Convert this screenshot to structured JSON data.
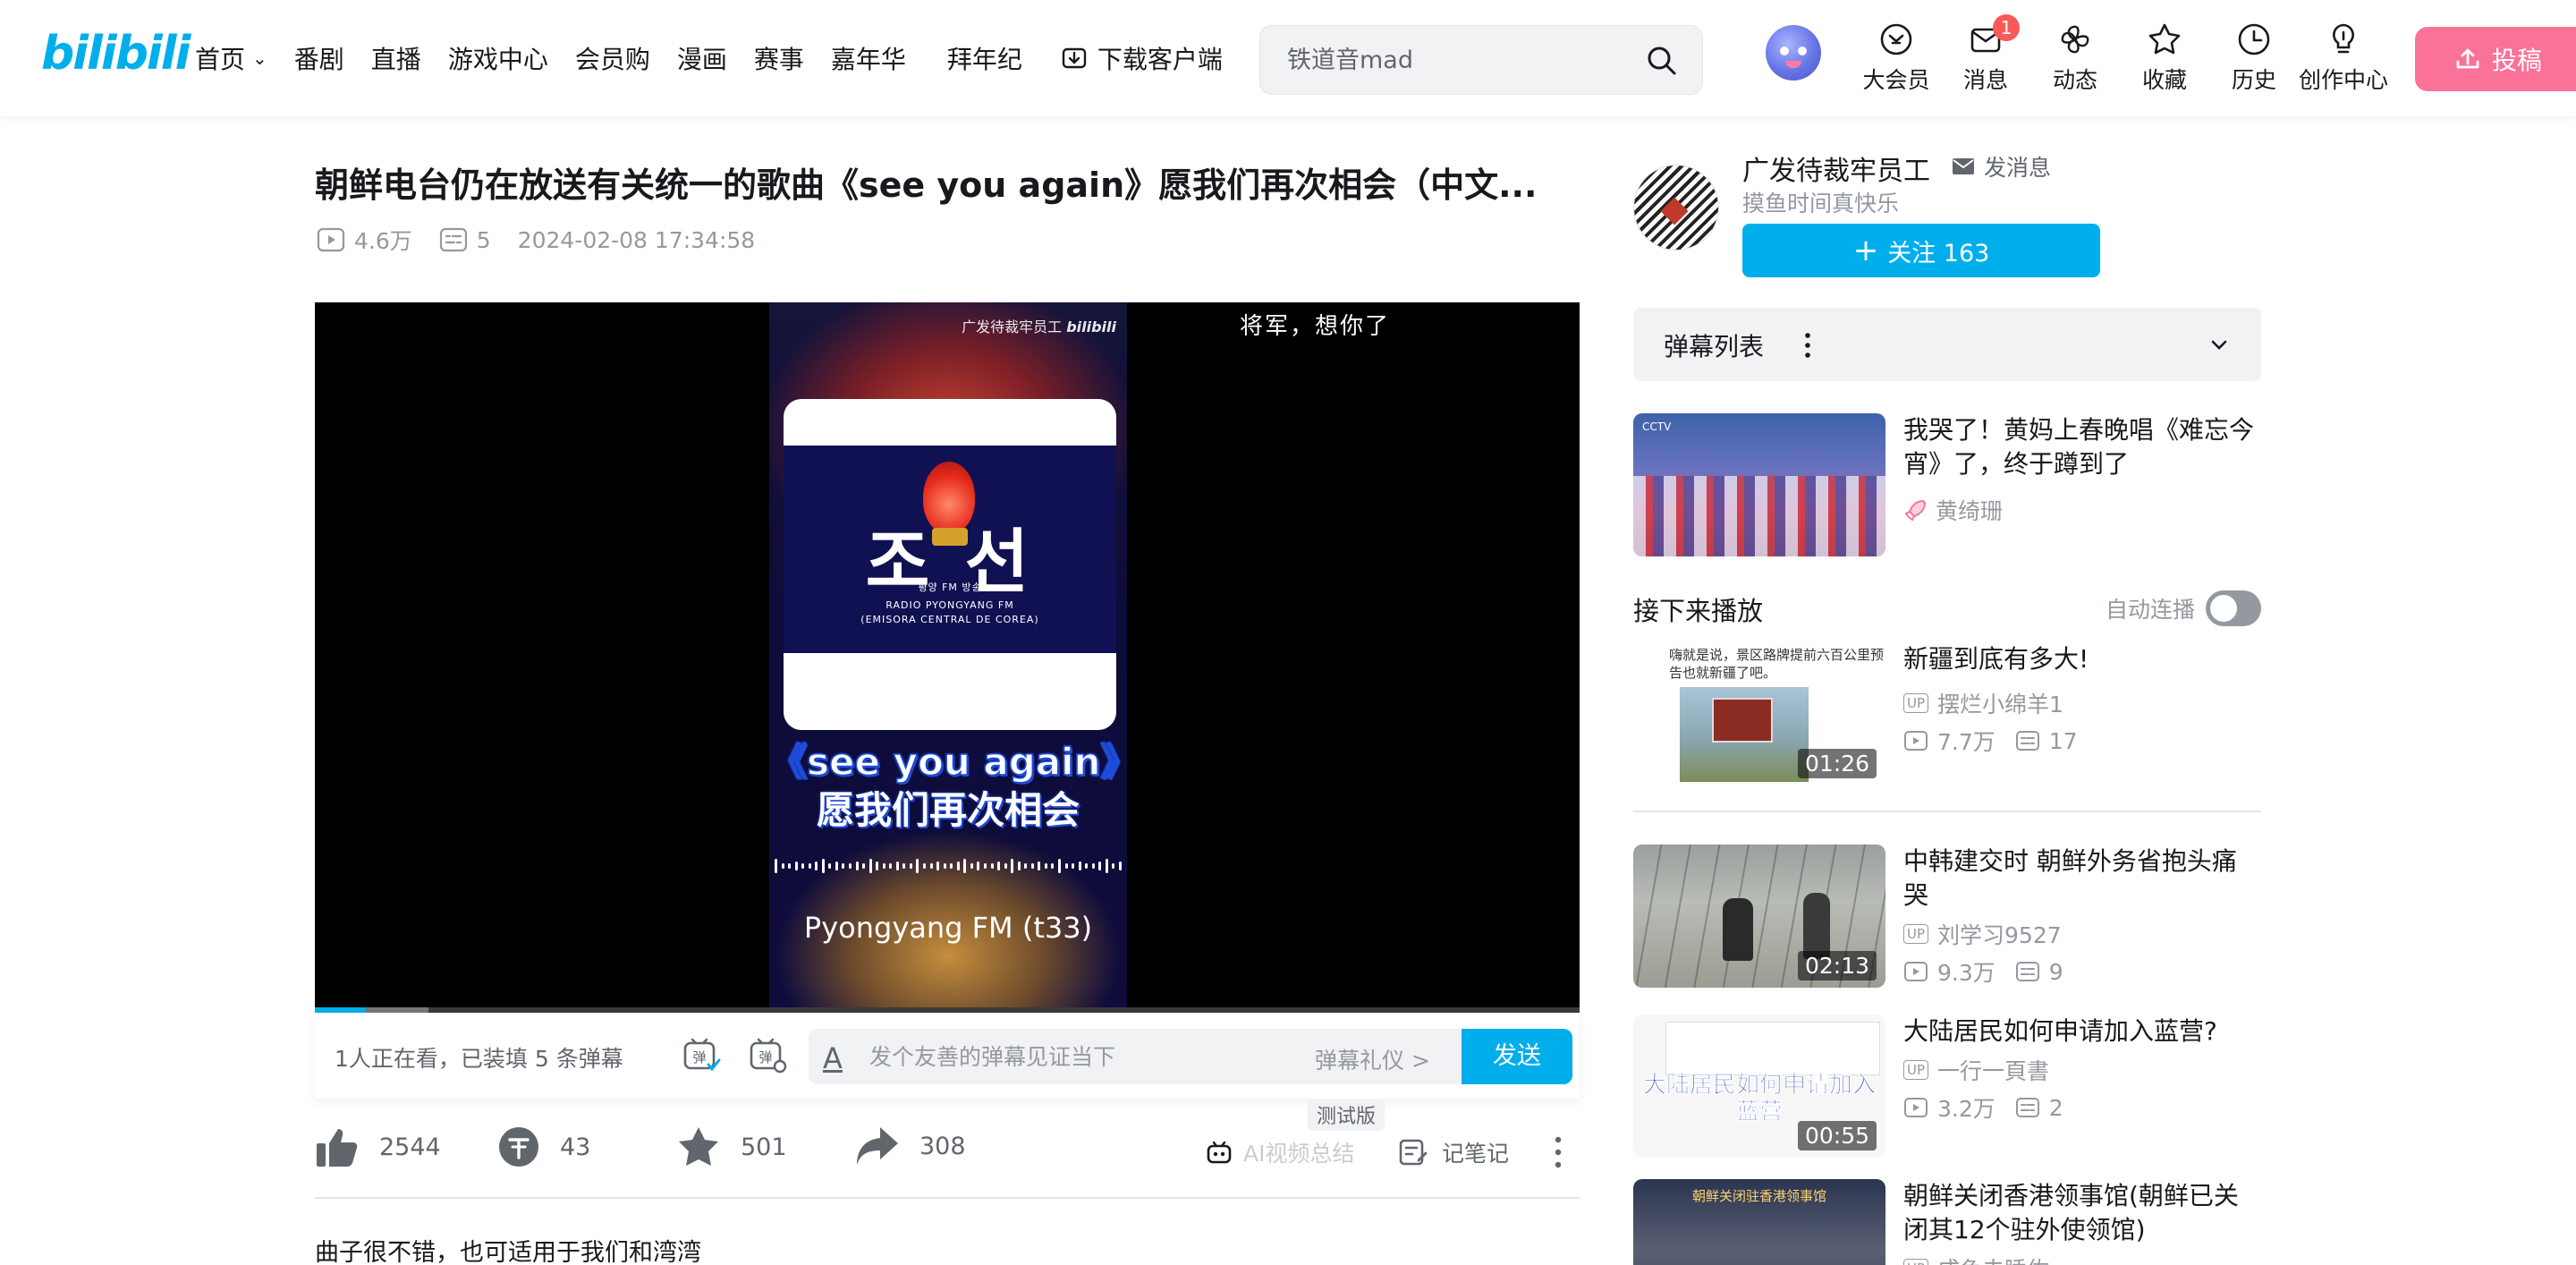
{
  "nav": {
    "logo": "bilibili",
    "links": [
      "首页",
      "番剧",
      "直播",
      "游戏中心",
      "会员购",
      "漫画",
      "赛事",
      "嘉年华",
      "拜年纪"
    ],
    "download": "下载客户端",
    "search_placeholder": "铁道音mad",
    "icons": [
      {
        "label": "大会员",
        "icon": "vip-icon"
      },
      {
        "label": "消息",
        "icon": "message-icon",
        "badge": "1"
      },
      {
        "label": "动态",
        "icon": "dynamic-icon"
      },
      {
        "label": "收藏",
        "icon": "favorite-icon"
      },
      {
        "label": "历史",
        "icon": "history-icon"
      },
      {
        "label": "创作中心",
        "icon": "creator-icon"
      }
    ],
    "upload": "投稿"
  },
  "video": {
    "title": "朝鲜电台仍在放送有关统一的歌曲《see you again》愿我们再次相会（中文...",
    "views": "4.6万",
    "danmaku_count": "5",
    "date": "2024-02-08 17:34:58"
  },
  "player": {
    "watermark": "广发待裁牢员工",
    "danmaku_text": "将军，想你了",
    "logo_line1": "평양 FM 방송",
    "logo_line2": "RADIO PYONGYANG FM",
    "logo_line3": "(EMISORA CENTRAL DE COREA)",
    "subtitle1": "《see you again》",
    "subtitle2": "愿我们再次相会",
    "station": "Pyongyang FM (t33)",
    "progress": 0.04,
    "buffered": 0.09
  },
  "danmaku_bar": {
    "watching": "1人正在看，已装填 5 条弹幕",
    "placeholder": "发个友善的弹幕见证当下",
    "etiquette": "弹幕礼仪 >",
    "send": "发送"
  },
  "actions": {
    "like": "2544",
    "coin": "43",
    "favorite": "501",
    "share": "308",
    "ai_summary": "AI视频总结",
    "trial": "测试版",
    "notes": "记笔记"
  },
  "description": "曲子很不错，也可适用于我们和湾湾",
  "uploader": {
    "name": "广发待裁牢员工",
    "message": "发消息",
    "sign": "摸鱼时间真快乐",
    "follow": "关注 163"
  },
  "danmaku_panel": {
    "title": "弹幕列表"
  },
  "recommend_top": {
    "title": "我哭了！黄妈上春晚唱《难忘今宵》了，终于蹲到了",
    "author": "黄绮珊"
  },
  "next": {
    "header": "接下来播放",
    "autoplay": "自动连播"
  },
  "recs": [
    {
      "title": "新疆到底有多大!",
      "author": "摆烂小绵羊1",
      "views": "7.7万",
      "danmaku": "17",
      "duration": "01:26",
      "thumb_text": "嗨就是说，景区路牌提前六百公里预告也就新疆了吧。"
    },
    {
      "title": "中韩建交时 朝鲜外务省抱头痛哭",
      "author": "刘学习9527",
      "views": "9.3万",
      "danmaku": "9",
      "duration": "02:13"
    },
    {
      "title": "大陆居民如何申请加入蓝营?",
      "author": "一行一頁書",
      "views": "3.2万",
      "danmaku": "2",
      "duration": "00:55",
      "thumb_text": "大陆居民如何申请加入蓝营"
    },
    {
      "title": "朝鲜关闭香港领事馆(朝鲜已关闭其12个驻外使领馆)",
      "author": "成色未睡佐"
    }
  ],
  "colors": {
    "brand_blue": "#00aeec",
    "brand_pink": "#fb7299",
    "text_main": "#18191c",
    "text_secondary": "#9499a0"
  }
}
